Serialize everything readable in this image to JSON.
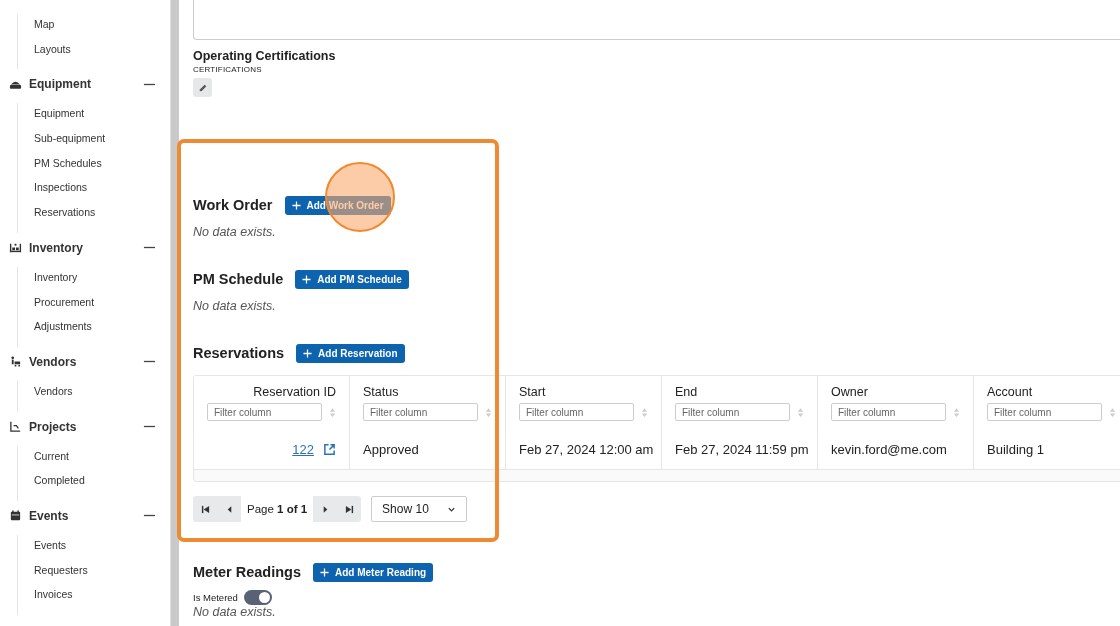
{
  "sidebar": {
    "top_items": [
      "Map",
      "Layouts"
    ],
    "groups": [
      {
        "label": "Equipment",
        "expanded": true,
        "items": [
          "Equipment",
          "Sub-equipment",
          "PM Schedules",
          "Inspections",
          "Reservations"
        ]
      },
      {
        "label": "Inventory",
        "expanded": true,
        "items": [
          "Inventory",
          "Procurement",
          "Adjustments"
        ]
      },
      {
        "label": "Vendors",
        "expanded": true,
        "items": [
          "Vendors"
        ]
      },
      {
        "label": "Projects",
        "expanded": true,
        "items": [
          "Current",
          "Completed"
        ]
      },
      {
        "label": "Events",
        "expanded": true,
        "items": [
          "Events",
          "Requesters",
          "Invoices"
        ]
      }
    ]
  },
  "certifications": {
    "title": "Operating Certifications",
    "subtitle": "CERTIFICATIONS"
  },
  "sections": [
    {
      "title": "Work Order",
      "button": "Add Work Order",
      "empty": "No data exists."
    },
    {
      "title": "PM Schedule",
      "button": "Add PM Schedule",
      "empty": "No data exists."
    },
    {
      "title": "Reservations",
      "button": "Add Reservation"
    }
  ],
  "table": {
    "columns": [
      {
        "label": "Reservation ID",
        "filter_placeholder": "Filter column"
      },
      {
        "label": "Status",
        "filter_placeholder": "Filter column"
      },
      {
        "label": "Start",
        "filter_placeholder": "Filter column"
      },
      {
        "label": "End",
        "filter_placeholder": "Filter column"
      },
      {
        "label": "Owner",
        "filter_placeholder": "Filter column"
      },
      {
        "label": "Account",
        "filter_placeholder": "Filter column"
      }
    ],
    "rows": [
      {
        "cells": [
          "122",
          "Approved",
          "Feb 27, 2024 12:00 am",
          "Feb 27, 2024 11:59 pm",
          "kevin.ford@me.com",
          "Building 1"
        ]
      }
    ]
  },
  "pagination": {
    "page": "Page **1 of 1**",
    "page_size": "Show 10"
  },
  "meter": {
    "title": "Meter Readings",
    "button": "Add Meter Reading",
    "toggle": {
      "label": "Is Metered",
      "on": true
    },
    "empty": "No data exists."
  }
}
